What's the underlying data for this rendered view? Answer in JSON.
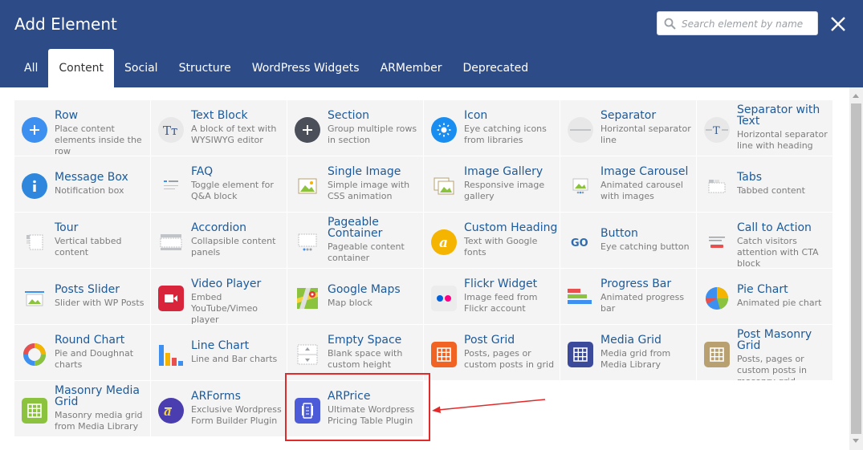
{
  "header": {
    "title": "Add Element",
    "search_placeholder": "Search element by name",
    "tabs": [
      {
        "label": "All"
      },
      {
        "label": "Content"
      },
      {
        "label": "Social"
      },
      {
        "label": "Structure"
      },
      {
        "label": "WordPress Widgets"
      },
      {
        "label": "ARMember"
      },
      {
        "label": "Deprecated"
      }
    ],
    "active_tab": "Content"
  },
  "elements": [
    {
      "name": "Row",
      "desc": "Place content elements inside the row",
      "icon": "plus-icon",
      "color": "#3d8ff0"
    },
    {
      "name": "Text Block",
      "desc": "A block of text with WYSIWYG editor",
      "icon": "text-block-icon",
      "color": "#e8e8e8"
    },
    {
      "name": "Section",
      "desc": "Group multiple rows in section",
      "icon": "plus-icon",
      "color": "#4a4f5a"
    },
    {
      "name": "Icon",
      "desc": "Eye catching icons from libraries",
      "icon": "sun-icon",
      "color": "#1a8ef0"
    },
    {
      "name": "Separator",
      "desc": "Horizontal separator line",
      "icon": "separator-icon",
      "color": "#e8e8e8"
    },
    {
      "name": "Separator with Text",
      "desc": "Horizontal separator line with heading",
      "icon": "separator-text-icon",
      "color": "#e8e8e8"
    },
    {
      "name": "Message Box",
      "desc": "Notification box",
      "icon": "info-icon",
      "color": "#2f86dd"
    },
    {
      "name": "FAQ",
      "desc": "Toggle element for Q&A block",
      "icon": "faq-icon",
      "color": "#e8e8e8"
    },
    {
      "name": "Single Image",
      "desc": "Simple image with CSS animation",
      "icon": "image-icon",
      "color": "#e8e8e8"
    },
    {
      "name": "Image Gallery",
      "desc": "Responsive image gallery",
      "icon": "gallery-icon",
      "color": "#e8e8e8"
    },
    {
      "name": "Image Carousel",
      "desc": "Animated carousel with images",
      "icon": "carousel-icon",
      "color": "#e8e8e8"
    },
    {
      "name": "Tabs",
      "desc": "Tabbed content",
      "icon": "tabs-icon",
      "color": "#e8e8e8"
    },
    {
      "name": "Tour",
      "desc": "Vertical tabbed content",
      "icon": "tour-icon",
      "color": "#e8e8e8"
    },
    {
      "name": "Accordion",
      "desc": "Collapsible content panels",
      "icon": "accordion-icon",
      "color": "#e8e8e8"
    },
    {
      "name": "Pageable Container",
      "desc": "Pageable content container",
      "icon": "pageable-icon",
      "color": "#e8e8e8"
    },
    {
      "name": "Custom Heading",
      "desc": "Text with Google fonts",
      "icon": "heading-icon",
      "color": "#f5b400"
    },
    {
      "name": "Button",
      "desc": "Eye catching button",
      "icon": "go-button-icon",
      "color": "#e8e8e8"
    },
    {
      "name": "Call to Action",
      "desc": "Catch visitors attention with CTA block",
      "icon": "cta-icon",
      "color": "#e8e8e8"
    },
    {
      "name": "Posts Slider",
      "desc": "Slider with WP Posts",
      "icon": "posts-slider-icon",
      "color": "#e8e8e8"
    },
    {
      "name": "Video Player",
      "desc": "Embed YouTube/Vimeo player",
      "icon": "video-icon",
      "color": "#d8253c"
    },
    {
      "name": "Google Maps",
      "desc": "Map block",
      "icon": "map-icon",
      "color": "#e8e8e8"
    },
    {
      "name": "Flickr Widget",
      "desc": "Image feed from Flickr account",
      "icon": "flickr-icon",
      "color": "#e8e8e8"
    },
    {
      "name": "Progress Bar",
      "desc": "Animated progress bar",
      "icon": "progress-icon",
      "color": "#e8e8e8"
    },
    {
      "name": "Pie Chart",
      "desc": "Animated pie chart",
      "icon": "pie-icon",
      "color": "#e8e8e8"
    },
    {
      "name": "Round Chart",
      "desc": "Pie and Doughnat charts",
      "icon": "round-chart-icon",
      "color": "#e8e8e8"
    },
    {
      "name": "Line Chart",
      "desc": "Line and Bar charts",
      "icon": "line-chart-icon",
      "color": "#e8e8e8"
    },
    {
      "name": "Empty Space",
      "desc": "Blank space with custom height",
      "icon": "empty-space-icon",
      "color": "#e8e8e8"
    },
    {
      "name": "Post Grid",
      "desc": "Posts, pages or custom posts in grid",
      "icon": "grid-icon",
      "color": "#f06322"
    },
    {
      "name": "Media Grid",
      "desc": "Media grid from Media Library",
      "icon": "grid-icon",
      "color": "#3c4a9c"
    },
    {
      "name": "Post Masonry Grid",
      "desc": "Posts, pages or custom posts in masonry grid",
      "icon": "grid-icon",
      "color": "#b8a070"
    },
    {
      "name": "Masonry Media Grid",
      "desc": "Masonry media grid from Media Library",
      "icon": "grid-icon",
      "color": "#8bc33f"
    },
    {
      "name": "ARForms",
      "desc": "Exclusive Wordpress Form Builder Plugin",
      "icon": "arforms-icon",
      "color": "#4a3db0"
    },
    {
      "name": "ARPrice",
      "desc": "Ultimate Wordpress Pricing Table Plugin",
      "icon": "arprice-icon",
      "color": "#4c5bd8"
    }
  ]
}
